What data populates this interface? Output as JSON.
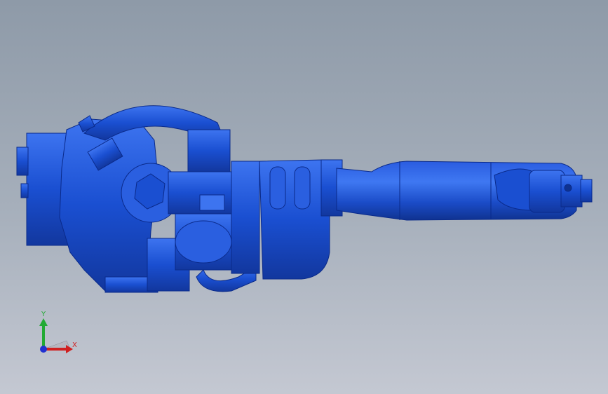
{
  "viewport": {
    "background_top": "#8e9aa8",
    "background_bottom": "#c4c8d2",
    "model_color": "#1a4fd1",
    "model_edge_color": "#0a2a8a",
    "model_highlight": "#3d74f0"
  },
  "triad": {
    "x_label": "X",
    "y_label": "Y",
    "x_color": "#d02020",
    "y_color": "#22aa33",
    "z_color": "#2030d0"
  }
}
